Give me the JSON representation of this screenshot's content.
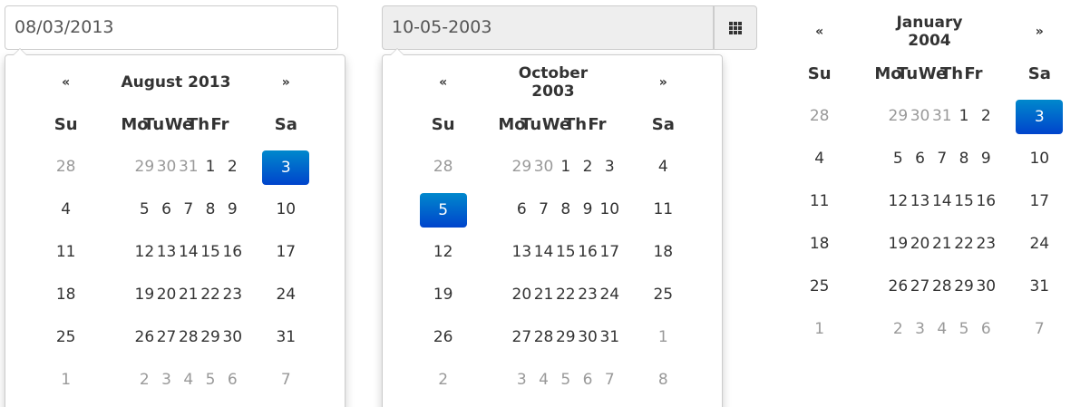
{
  "pickers": [
    {
      "value": "08/03/2013",
      "title": "August 2013",
      "prev": "«",
      "next": "»",
      "weekdays": [
        "Su",
        "Mo",
        "Tu",
        "We",
        "Th",
        "Fr",
        "Sa"
      ],
      "weeks": [
        [
          {
            "d": "28",
            "m": true
          },
          {
            "d": "29",
            "m": true
          },
          {
            "d": "30",
            "m": true
          },
          {
            "d": "31",
            "m": true
          },
          {
            "d": "1"
          },
          {
            "d": "2"
          },
          {
            "d": "3",
            "a": true
          }
        ],
        [
          {
            "d": "4"
          },
          {
            "d": "5"
          },
          {
            "d": "6"
          },
          {
            "d": "7"
          },
          {
            "d": "8"
          },
          {
            "d": "9"
          },
          {
            "d": "10"
          }
        ],
        [
          {
            "d": "11"
          },
          {
            "d": "12"
          },
          {
            "d": "13"
          },
          {
            "d": "14"
          },
          {
            "d": "15"
          },
          {
            "d": "16"
          },
          {
            "d": "17"
          }
        ],
        [
          {
            "d": "18"
          },
          {
            "d": "19"
          },
          {
            "d": "20"
          },
          {
            "d": "21"
          },
          {
            "d": "22"
          },
          {
            "d": "23"
          },
          {
            "d": "24"
          }
        ],
        [
          {
            "d": "25"
          },
          {
            "d": "26"
          },
          {
            "d": "27"
          },
          {
            "d": "28"
          },
          {
            "d": "29"
          },
          {
            "d": "30"
          },
          {
            "d": "31"
          }
        ],
        [
          {
            "d": "1",
            "m": true
          },
          {
            "d": "2",
            "m": true
          },
          {
            "d": "3",
            "m": true
          },
          {
            "d": "4",
            "m": true
          },
          {
            "d": "5",
            "m": true
          },
          {
            "d": "6",
            "m": true
          },
          {
            "d": "7",
            "m": true
          }
        ]
      ]
    },
    {
      "value": "10-05-2003",
      "addon_icon": "grid-icon",
      "title": "October 2003",
      "prev": "«",
      "next": "»",
      "weekdays": [
        "Su",
        "Mo",
        "Tu",
        "We",
        "Th",
        "Fr",
        "Sa"
      ],
      "weeks": [
        [
          {
            "d": "28",
            "m": true
          },
          {
            "d": "29",
            "m": true
          },
          {
            "d": "30",
            "m": true
          },
          {
            "d": "1"
          },
          {
            "d": "2"
          },
          {
            "d": "3"
          },
          {
            "d": "4"
          }
        ],
        [
          {
            "d": "5",
            "a": true
          },
          {
            "d": "6"
          },
          {
            "d": "7"
          },
          {
            "d": "8"
          },
          {
            "d": "9"
          },
          {
            "d": "10"
          },
          {
            "d": "11"
          }
        ],
        [
          {
            "d": "12"
          },
          {
            "d": "13"
          },
          {
            "d": "14"
          },
          {
            "d": "15"
          },
          {
            "d": "16"
          },
          {
            "d": "17"
          },
          {
            "d": "18"
          }
        ],
        [
          {
            "d": "19"
          },
          {
            "d": "20"
          },
          {
            "d": "21"
          },
          {
            "d": "22"
          },
          {
            "d": "23"
          },
          {
            "d": "24"
          },
          {
            "d": "25"
          }
        ],
        [
          {
            "d": "26"
          },
          {
            "d": "27"
          },
          {
            "d": "28"
          },
          {
            "d": "29"
          },
          {
            "d": "30"
          },
          {
            "d": "31"
          },
          {
            "d": "1",
            "m": true
          }
        ],
        [
          {
            "d": "2",
            "m": true
          },
          {
            "d": "3",
            "m": true
          },
          {
            "d": "4",
            "m": true
          },
          {
            "d": "5",
            "m": true
          },
          {
            "d": "6",
            "m": true
          },
          {
            "d": "7",
            "m": true
          },
          {
            "d": "8",
            "m": true
          }
        ]
      ]
    },
    {
      "title": "January 2004",
      "prev": "«",
      "next": "»",
      "weekdays": [
        "Su",
        "Mo",
        "Tu",
        "We",
        "Th",
        "Fr",
        "Sa"
      ],
      "weeks": [
        [
          {
            "d": "28",
            "m": true
          },
          {
            "d": "29",
            "m": true
          },
          {
            "d": "30",
            "m": true
          },
          {
            "d": "31",
            "m": true
          },
          {
            "d": "1"
          },
          {
            "d": "2"
          },
          {
            "d": "3",
            "a": true
          }
        ],
        [
          {
            "d": "4"
          },
          {
            "d": "5"
          },
          {
            "d": "6"
          },
          {
            "d": "7"
          },
          {
            "d": "8"
          },
          {
            "d": "9"
          },
          {
            "d": "10"
          }
        ],
        [
          {
            "d": "11"
          },
          {
            "d": "12"
          },
          {
            "d": "13"
          },
          {
            "d": "14"
          },
          {
            "d": "15"
          },
          {
            "d": "16"
          },
          {
            "d": "17"
          }
        ],
        [
          {
            "d": "18"
          },
          {
            "d": "19"
          },
          {
            "d": "20"
          },
          {
            "d": "21"
          },
          {
            "d": "22"
          },
          {
            "d": "23"
          },
          {
            "d": "24"
          }
        ],
        [
          {
            "d": "25"
          },
          {
            "d": "26"
          },
          {
            "d": "27"
          },
          {
            "d": "28"
          },
          {
            "d": "29"
          },
          {
            "d": "30"
          },
          {
            "d": "31"
          }
        ],
        [
          {
            "d": "1",
            "m": true
          },
          {
            "d": "2",
            "m": true
          },
          {
            "d": "3",
            "m": true
          },
          {
            "d": "4",
            "m": true
          },
          {
            "d": "5",
            "m": true
          },
          {
            "d": "6",
            "m": true
          },
          {
            "d": "7",
            "m": true
          }
        ]
      ]
    }
  ],
  "colors": {
    "active_top": "#0088cc",
    "active_bottom": "#0044cc",
    "muted_text": "#999999",
    "border": "#cccccc"
  }
}
